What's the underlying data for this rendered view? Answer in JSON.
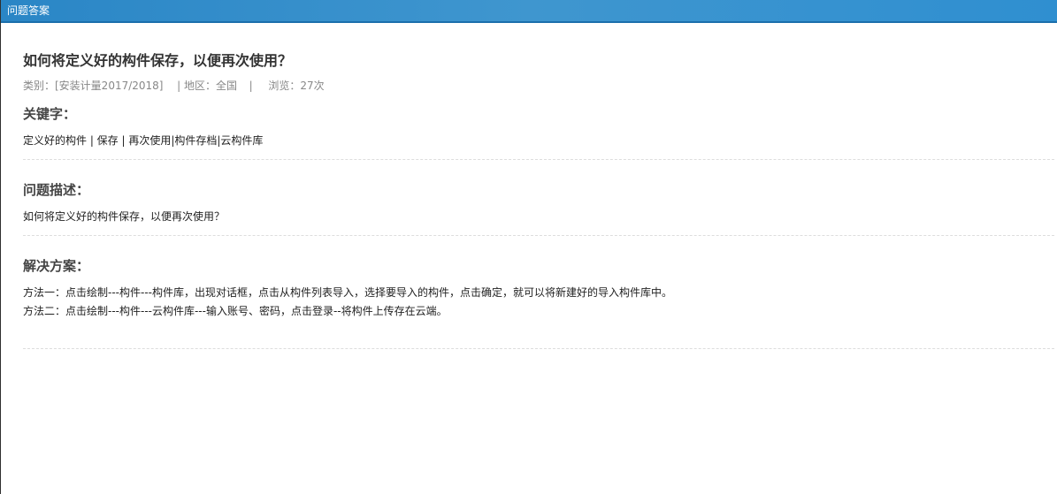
{
  "window": {
    "title": "问题答案"
  },
  "question": {
    "title": "如何将定义好的构件保存，以便再次使用？",
    "meta": {
      "category": "类别：[安装计量2017/2018]",
      "region": "| 地区：全国",
      "separator": "|",
      "views": "浏览：27次"
    }
  },
  "keywords": {
    "heading": "关键字：",
    "text": "定义好的构件 | 保存 | 再次使用|构件存档|云构件库"
  },
  "description": {
    "heading": "问题描述：",
    "text": "如何将定义好的构件保存，以便再次使用？"
  },
  "solution": {
    "heading": "解决方案：",
    "lines": [
      "方法一：点击绘制---构件---构件库，出现对话框，点击从构件列表导入，选择要导入的构件，点击确定，就可以将新建好的导入构件库中。",
      "方法二：点击绘制---构件---云构件库---输入账号、密码，点击登录--将构件上传存在云端。"
    ]
  }
}
